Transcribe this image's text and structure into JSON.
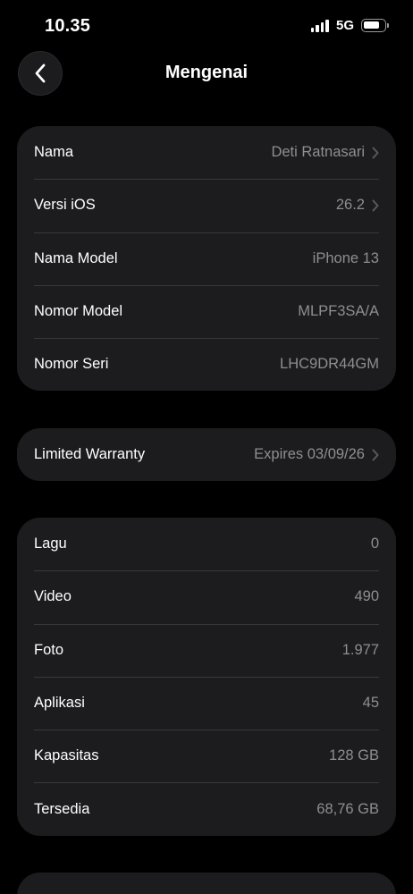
{
  "status_bar": {
    "time": "10.35",
    "network": "5G",
    "battery_level": 0.8,
    "signal_bars": 4
  },
  "nav": {
    "title": "Mengenai",
    "back_icon": "chevron-left-icon"
  },
  "groups": [
    {
      "rows": [
        {
          "label": "Nama",
          "value": "Deti Ratnasari",
          "chevron": true
        },
        {
          "label": "Versi iOS",
          "value": "26.2",
          "chevron": true
        },
        {
          "label": "Nama Model",
          "value": "iPhone 13",
          "chevron": false
        },
        {
          "label": "Nomor Model",
          "value": "MLPF3SA/A",
          "chevron": false
        },
        {
          "label": "Nomor Seri",
          "value": "LHC9DR44GM",
          "chevron": false
        }
      ]
    },
    {
      "rows": [
        {
          "label": "Limited Warranty",
          "value": "Expires 03/09/26",
          "chevron": true
        }
      ]
    },
    {
      "rows": [
        {
          "label": "Lagu",
          "value": "0",
          "chevron": false
        },
        {
          "label": "Video",
          "value": "490",
          "chevron": false
        },
        {
          "label": "Foto",
          "value": "1.977",
          "chevron": false
        },
        {
          "label": "Aplikasi",
          "value": "45",
          "chevron": false
        },
        {
          "label": "Kapasitas",
          "value": "128 GB",
          "chevron": false
        },
        {
          "label": "Tersedia",
          "value": "68,76 GB",
          "chevron": false
        }
      ]
    }
  ],
  "colors": {
    "background": "#000000",
    "card": "#1c1c1e",
    "separator": "#38383a",
    "secondary_text": "#8e8e93",
    "chevron": "#5a5a5e"
  }
}
